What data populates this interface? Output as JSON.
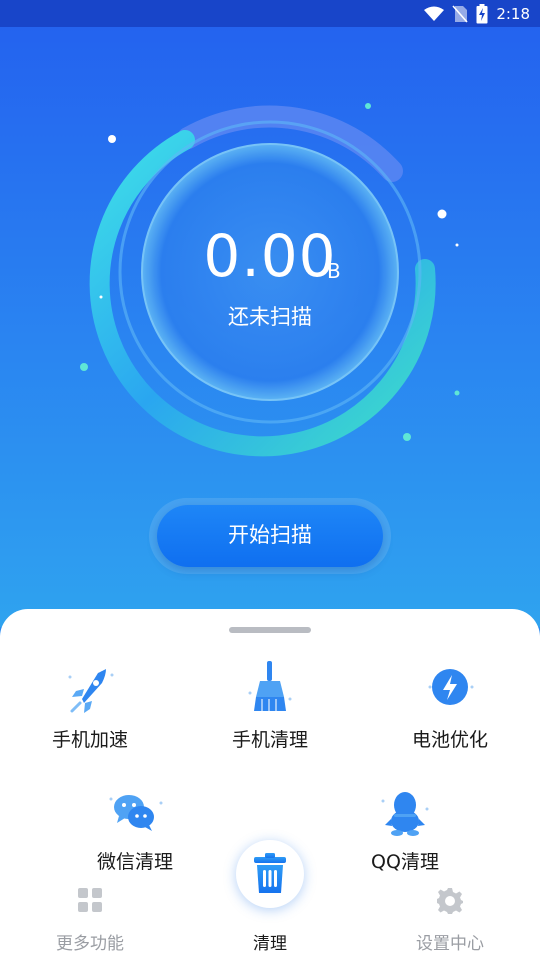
{
  "status_bar": {
    "time": "2:18"
  },
  "scan": {
    "size_value": "0.00",
    "size_unit": "B",
    "status_text": "还未扫描",
    "start_button": "开始扫描"
  },
  "features": [
    {
      "label": "手机加速",
      "icon": "rocket-icon"
    },
    {
      "label": "手机清理",
      "icon": "broom-icon"
    },
    {
      "label": "电池优化",
      "icon": "lightning-icon"
    },
    {
      "label": "微信清理",
      "icon": "wechat-icon"
    },
    {
      "label": "QQ清理",
      "icon": "qq-penguin-icon"
    }
  ],
  "bottom_nav": {
    "items": [
      {
        "label": "更多功能",
        "icon": "grid-icon",
        "active": false
      },
      {
        "label": "清理",
        "icon": "trash-icon",
        "active": true
      },
      {
        "label": "设置中心",
        "icon": "gear-icon",
        "active": false
      }
    ]
  },
  "colors": {
    "primary": "#1e86f7",
    "hero_top": "#2463ef",
    "hero_bottom": "#2fa3ef",
    "accent_teal": "#3fe0c8"
  }
}
